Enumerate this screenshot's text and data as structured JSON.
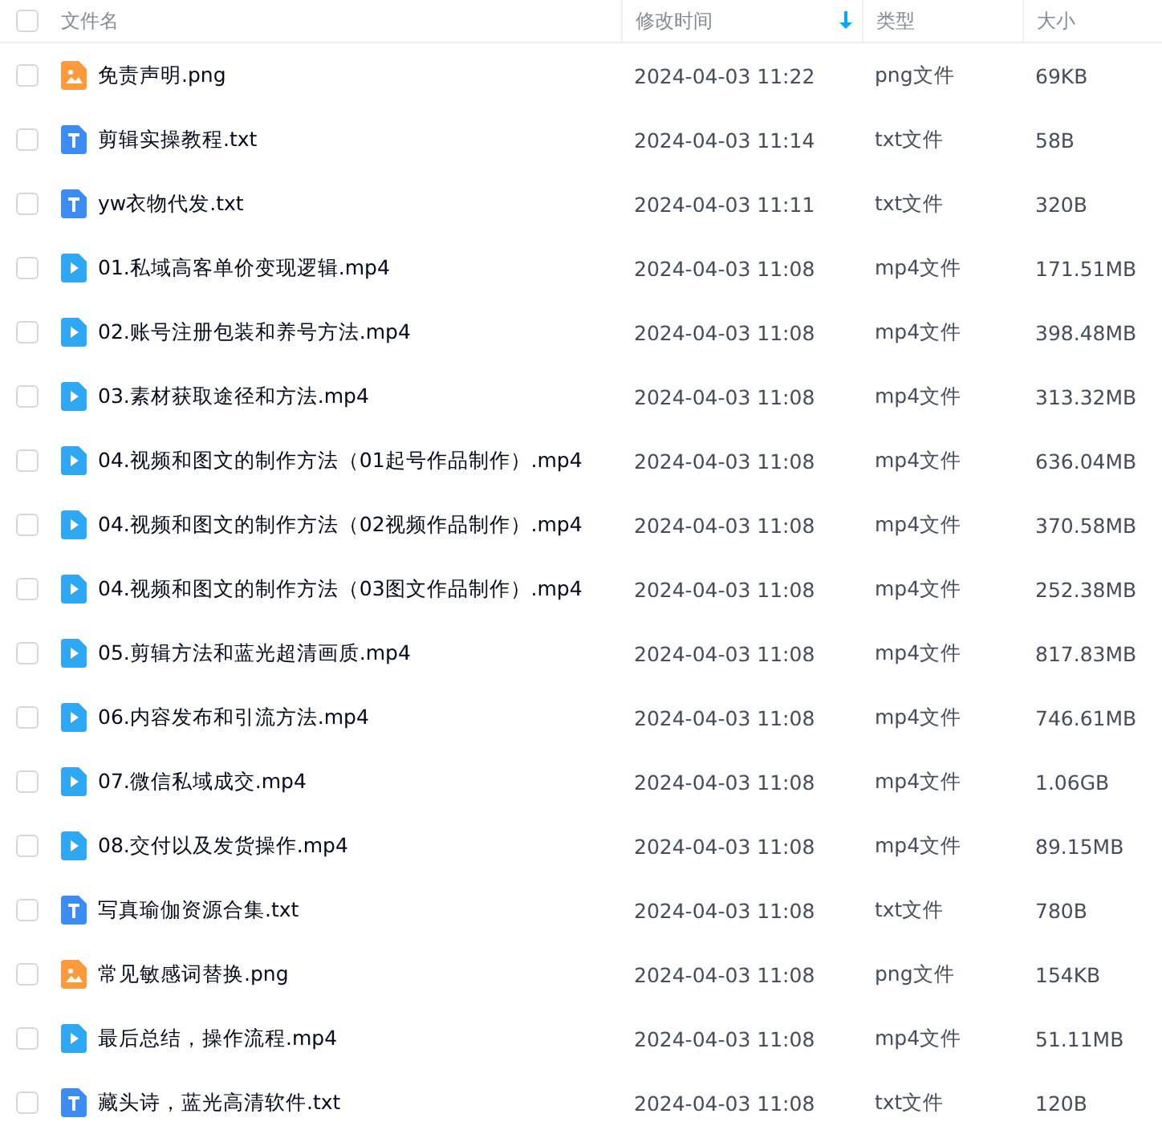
{
  "header": {
    "select_all_checked": false,
    "columns": [
      {
        "label": "文件名",
        "sorted": false
      },
      {
        "label": "修改时间",
        "sorted": true
      },
      {
        "label": "类型",
        "sorted": false
      },
      {
        "label": "大小",
        "sorted": false
      }
    ]
  },
  "files": [
    {
      "kind": "image",
      "name": "免责声明.png",
      "modified": "2024-04-03 11:22",
      "type": "png文件",
      "size": "69KB",
      "checked": false
    },
    {
      "kind": "text",
      "name": "剪辑实操教程.txt",
      "modified": "2024-04-03 11:14",
      "type": "txt文件",
      "size": "58B",
      "checked": false
    },
    {
      "kind": "text",
      "name": "yw衣物代发.txt",
      "modified": "2024-04-03 11:11",
      "type": "txt文件",
      "size": "320B",
      "checked": false
    },
    {
      "kind": "video",
      "name": "01.私域高客单价变现逻辑.mp4",
      "modified": "2024-04-03 11:08",
      "type": "mp4文件",
      "size": "171.51MB",
      "checked": false
    },
    {
      "kind": "video",
      "name": "02.账号注册包装和养号方法.mp4",
      "modified": "2024-04-03 11:08",
      "type": "mp4文件",
      "size": "398.48MB",
      "checked": false
    },
    {
      "kind": "video",
      "name": "03.素材获取途径和方法.mp4",
      "modified": "2024-04-03 11:08",
      "type": "mp4文件",
      "size": "313.32MB",
      "checked": false
    },
    {
      "kind": "video",
      "name": "04.视频和图文的制作方法（01起号作品制作）.mp4",
      "modified": "2024-04-03 11:08",
      "type": "mp4文件",
      "size": "636.04MB",
      "checked": false
    },
    {
      "kind": "video",
      "name": "04.视频和图文的制作方法（02视频作品制作）.mp4",
      "modified": "2024-04-03 11:08",
      "type": "mp4文件",
      "size": "370.58MB",
      "checked": false
    },
    {
      "kind": "video",
      "name": "04.视频和图文的制作方法（03图文作品制作）.mp4",
      "modified": "2024-04-03 11:08",
      "type": "mp4文件",
      "size": "252.38MB",
      "checked": false
    },
    {
      "kind": "video",
      "name": "05.剪辑方法和蓝光超清画质.mp4",
      "modified": "2024-04-03 11:08",
      "type": "mp4文件",
      "size": "817.83MB",
      "checked": false
    },
    {
      "kind": "video",
      "name": "06.内容发布和引流方法.mp4",
      "modified": "2024-04-03 11:08",
      "type": "mp4文件",
      "size": "746.61MB",
      "checked": false
    },
    {
      "kind": "video",
      "name": "07.微信私域成交.mp4",
      "modified": "2024-04-03 11:08",
      "type": "mp4文件",
      "size": "1.06GB",
      "checked": false
    },
    {
      "kind": "video",
      "name": "08.交付以及发货操作.mp4",
      "modified": "2024-04-03 11:08",
      "type": "mp4文件",
      "size": "89.15MB",
      "checked": false
    },
    {
      "kind": "text",
      "name": "写真瑜伽资源合集.txt",
      "modified": "2024-04-03 11:08",
      "type": "txt文件",
      "size": "780B",
      "checked": false
    },
    {
      "kind": "image",
      "name": "常见敏感词替换.png",
      "modified": "2024-04-03 11:08",
      "type": "png文件",
      "size": "154KB",
      "checked": false
    },
    {
      "kind": "video",
      "name": "最后总结，操作流程.mp4",
      "modified": "2024-04-03 11:08",
      "type": "mp4文件",
      "size": "51.11MB",
      "checked": false
    },
    {
      "kind": "text",
      "name": "藏头诗，蓝光高清软件.txt",
      "modified": "2024-04-03 11:08",
      "type": "txt文件",
      "size": "120B",
      "checked": false
    }
  ]
}
